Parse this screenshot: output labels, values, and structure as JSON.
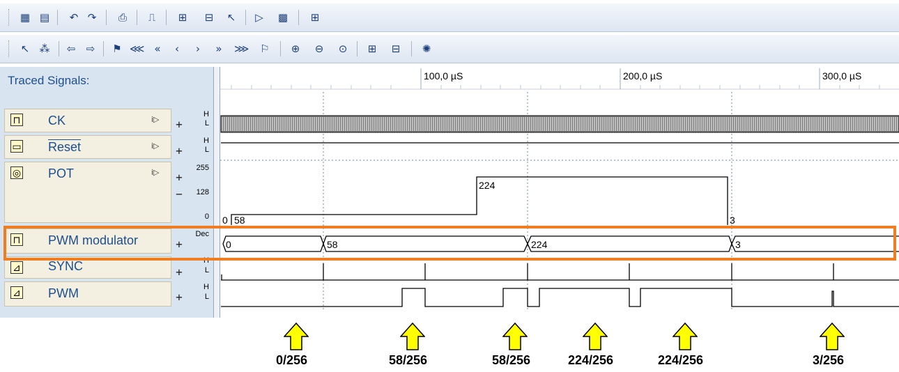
{
  "toolbar1": {
    "icons": [
      "toggle-probes-icon",
      "report-icon",
      "undo-icon",
      "redo-icon",
      "print-icon",
      "edge-icon",
      "split-icon",
      "group-icon",
      "cursor-icon",
      "play-icon",
      "stop-icon",
      "grid-icon"
    ]
  },
  "toolbar2": {
    "icons": [
      "select-icon",
      "filter-icon",
      "prev-marker-icon",
      "next-marker-icon",
      "bookmark-icon",
      "first-icon",
      "fast-back-icon",
      "back-icon",
      "forward-icon",
      "fast-forward-icon",
      "last-icon",
      "zoom-in-icon",
      "zoom-out-icon",
      "zoom-fit-icon",
      "add-probe-icon",
      "remove-probe-icon",
      "settings-icon"
    ]
  },
  "panel": {
    "title": "Traced Signals:"
  },
  "ruler": {
    "labels": [
      "100,0 µS",
      "200,0 µS",
      "300,0 µS"
    ]
  },
  "signals": [
    {
      "name": "CK",
      "scale_top": "H",
      "scale_bottom": "L"
    },
    {
      "name": "Reset",
      "scale_top": "H",
      "scale_bottom": "L"
    },
    {
      "name": "POT",
      "scale_top": "255",
      "scale_mid": "128",
      "scale_bottom": "0"
    },
    {
      "name": "PWM modulator",
      "scale_top": "Dec"
    },
    {
      "name": "SYNC",
      "scale_top": "H",
      "scale_bottom": "L"
    },
    {
      "name": "PWM",
      "scale_top": "H",
      "scale_bottom": "L"
    }
  ],
  "pot_values": [
    "0",
    "58",
    "224",
    "3"
  ],
  "bus_values": [
    "0",
    "58",
    "224",
    "3"
  ],
  "annotations": [
    "0/256",
    "58/256",
    "58/256",
    "224/256",
    "224/256",
    "3/256"
  ],
  "colors": {
    "highlight": "#f07d22",
    "arrow": "#ffff00"
  }
}
